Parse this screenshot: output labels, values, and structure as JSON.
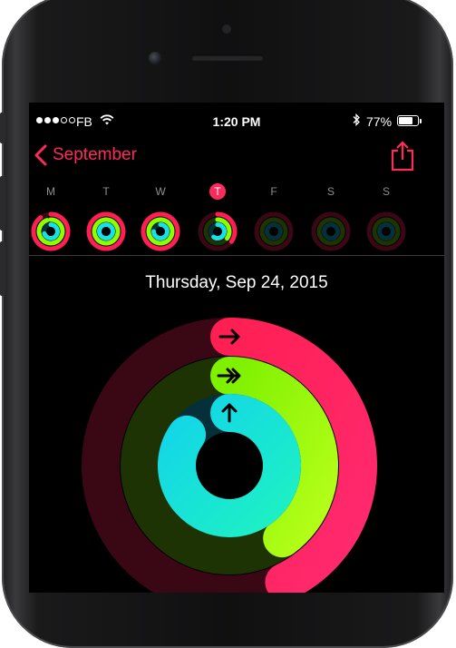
{
  "status_bar": {
    "signal_dots_filled": 3,
    "signal_dots_total": 5,
    "carrier": "FB",
    "time": "1:20 PM",
    "battery_percent": "77%",
    "battery_level": 0.77
  },
  "nav": {
    "back_label": "September",
    "accent_color": "#ff2a5c"
  },
  "week": {
    "days": [
      {
        "letter": "M",
        "move": 0.9,
        "exercise": 0.95,
        "stand": 0.7,
        "today": false
      },
      {
        "letter": "T",
        "move": 1.0,
        "exercise": 1.0,
        "stand": 1.0,
        "today": false
      },
      {
        "letter": "W",
        "move": 1.0,
        "exercise": 1.0,
        "stand": 0.75,
        "today": false
      },
      {
        "letter": "T",
        "move": 0.35,
        "exercise": 0.35,
        "stand": 0.6,
        "today": true
      },
      {
        "letter": "F",
        "move": 0,
        "exercise": 0,
        "stand": 0,
        "today": false
      },
      {
        "letter": "S",
        "move": 0,
        "exercise": 0,
        "stand": 0,
        "today": false
      },
      {
        "letter": "S",
        "move": 0,
        "exercise": 0,
        "stand": 0,
        "today": false
      }
    ]
  },
  "day_detail": {
    "date": "Thursday, Sep 24, 2015",
    "rings": [
      {
        "name": "move",
        "progress": 0.43,
        "color": "#ff1f53",
        "end_color": "#ff2a70",
        "track": "#3a0714"
      },
      {
        "name": "exercise",
        "progress": 0.4,
        "color": "#7ef000",
        "end_color": "#b6ff1a",
        "track": "#1d3303"
      },
      {
        "name": "stand",
        "progress": 0.85,
        "color": "#13d6e8",
        "end_color": "#1df0c4",
        "track": "#05303a"
      }
    ]
  },
  "colors": {
    "background": "#000000",
    "move": "#ff1f53",
    "exercise": "#8cff00",
    "stand": "#18e0e6"
  }
}
